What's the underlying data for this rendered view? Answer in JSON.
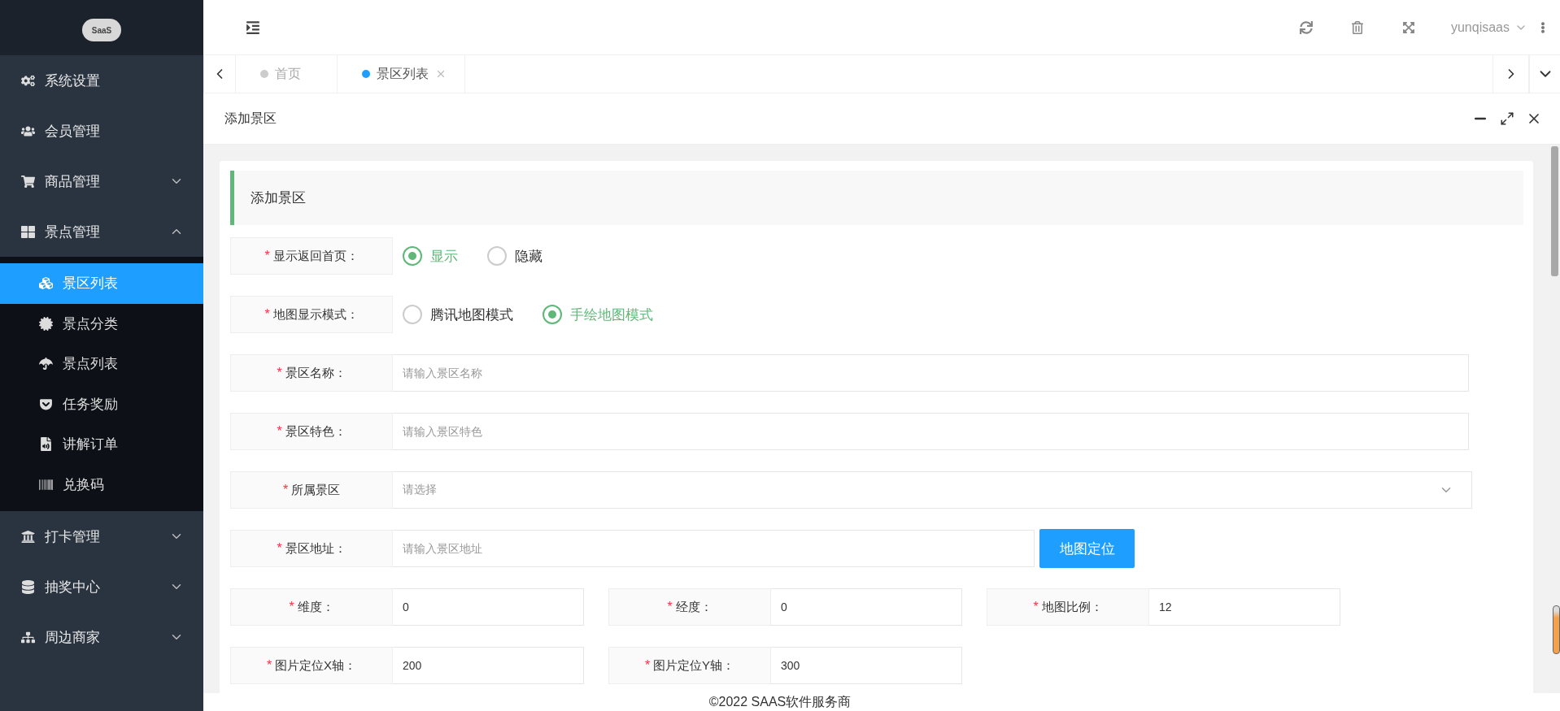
{
  "logo": {
    "text": "SaaS"
  },
  "sidebar": {
    "items": [
      {
        "label": "系统设置",
        "kind": "link"
      },
      {
        "label": "会员管理",
        "kind": "link"
      },
      {
        "label": "商品管理",
        "kind": "group",
        "expanded": false
      },
      {
        "label": "景点管理",
        "kind": "group",
        "expanded": true,
        "children": [
          {
            "label": "景区列表",
            "selected": true
          },
          {
            "label": "景点分类",
            "selected": false
          },
          {
            "label": "景点列表",
            "selected": false
          },
          {
            "label": "任务奖励",
            "selected": false
          },
          {
            "label": "讲解订单",
            "selected": false
          },
          {
            "label": "兑换码",
            "selected": false
          }
        ]
      },
      {
        "label": "打卡管理",
        "kind": "group",
        "expanded": false
      },
      {
        "label": "抽奖中心",
        "kind": "group",
        "expanded": false
      },
      {
        "label": "周边商家",
        "kind": "group",
        "expanded": false
      }
    ]
  },
  "header": {
    "username": "yunqisaas"
  },
  "tabs": [
    {
      "label": "首页",
      "selected": false,
      "closable": false
    },
    {
      "label": "景区列表",
      "selected": true,
      "closable": true
    }
  ],
  "panel": {
    "title": "添加景区"
  },
  "form": {
    "section_title": "添加景区",
    "rows": [
      {
        "kind": "radio",
        "mark": "*",
        "label": "显示返回首页：",
        "options": [
          {
            "label": "显示",
            "selected": true
          },
          {
            "label": "隐藏",
            "selected": false
          }
        ]
      },
      {
        "kind": "radio",
        "mark": "*",
        "label": "地图显示模式：",
        "options": [
          {
            "label": "腾讯地图模式",
            "selected": false
          },
          {
            "label": "手绘地图模式",
            "selected": true
          }
        ]
      },
      {
        "kind": "text",
        "mark": "*",
        "label": "景区名称：",
        "placeholder": "请输入景区名称"
      },
      {
        "kind": "text",
        "mark": "*",
        "label": "景区特色：",
        "placeholder": "请输入景区特色"
      },
      {
        "kind": "select",
        "mark": "*",
        "label": "所属景区",
        "placeholder": "请选择"
      },
      {
        "kind": "address",
        "mark": "*",
        "label": "景区地址：",
        "placeholder": "请输入景区地址",
        "button": "地图定位"
      },
      {
        "kind": "group",
        "fields": [
          {
            "mark": "*",
            "label": "维度：",
            "value": "0"
          },
          {
            "mark": "*",
            "label": "经度：",
            "value": "0"
          },
          {
            "mark": "*",
            "label": "地图比例：",
            "value": "12"
          }
        ]
      },
      {
        "kind": "group",
        "fields": [
          {
            "mark": "*",
            "label": "图片定位X轴：",
            "value": "200"
          },
          {
            "mark": "*",
            "label": "图片定位Y轴：",
            "value": "300"
          }
        ]
      }
    ]
  },
  "footer": {
    "text": "©2022 SAAS软件服务商"
  }
}
